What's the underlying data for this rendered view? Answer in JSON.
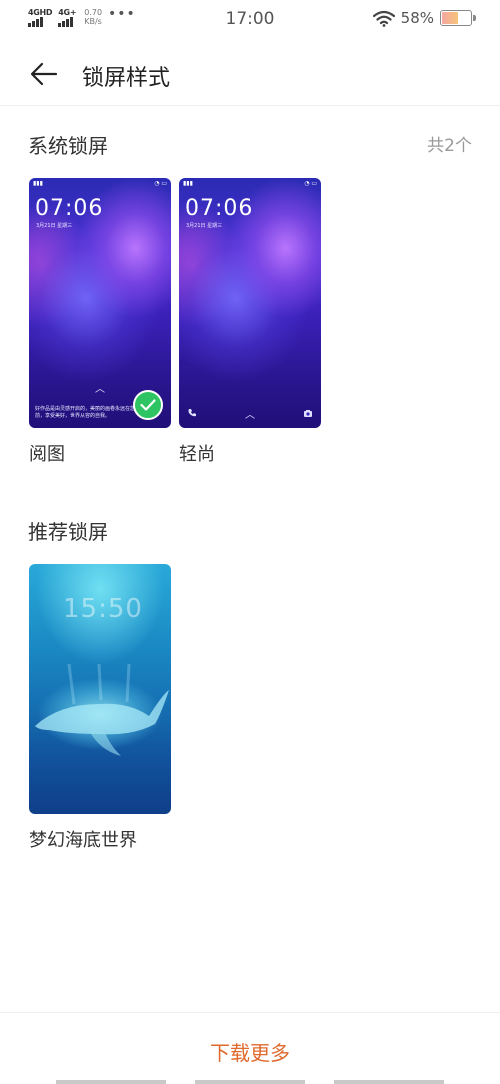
{
  "status_bar": {
    "net1_label": "4GHD",
    "net2_label": "4G+",
    "speed_value": "0.70",
    "speed_unit": "KB/s",
    "more": "•••",
    "time": "17:00",
    "battery_pct": "58%",
    "battery_level": 0.58,
    "icons": [
      "signal-icon",
      "wifi-icon",
      "battery-icon"
    ]
  },
  "header": {
    "title": "锁屏样式",
    "back_icon": "back-arrow-icon"
  },
  "system_section": {
    "title": "系统锁屏",
    "count": "共2个",
    "items": [
      {
        "label": "阅图",
        "time": "07:06",
        "date": "3月21日  星期三",
        "caption": "好作品是由灵感开启的，美丽的画卷永远在您的眼前，享受美好，世界从容的自我。",
        "selected": true
      },
      {
        "label": "轻尚",
        "time": "07:06",
        "date": "3月21日  星期三",
        "selected": false
      }
    ]
  },
  "recommend_section": {
    "title": "推荐锁屏",
    "items": [
      {
        "label": "梦幻海底世界",
        "time": "15:50"
      }
    ]
  },
  "bottom": {
    "download_more": "下载更多"
  },
  "colors": {
    "accent": "#e06a2e",
    "check": "#2fc463"
  }
}
